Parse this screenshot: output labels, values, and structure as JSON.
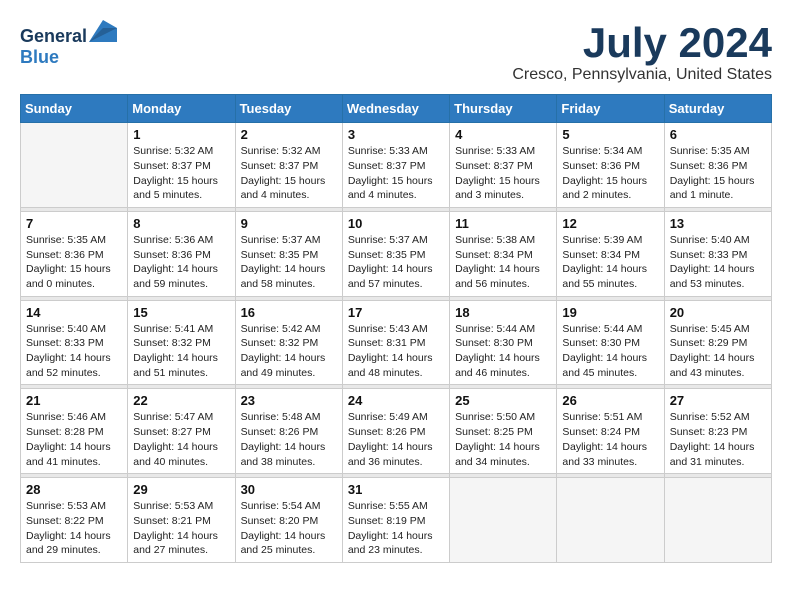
{
  "logo": {
    "general": "General",
    "blue": "Blue"
  },
  "title": "July 2024",
  "subtitle": "Cresco, Pennsylvania, United States",
  "days_of_week": [
    "Sunday",
    "Monday",
    "Tuesday",
    "Wednesday",
    "Thursday",
    "Friday",
    "Saturday"
  ],
  "weeks": [
    [
      {
        "day": "",
        "info": ""
      },
      {
        "day": "1",
        "info": "Sunrise: 5:32 AM\nSunset: 8:37 PM\nDaylight: 15 hours\nand 5 minutes."
      },
      {
        "day": "2",
        "info": "Sunrise: 5:32 AM\nSunset: 8:37 PM\nDaylight: 15 hours\nand 4 minutes."
      },
      {
        "day": "3",
        "info": "Sunrise: 5:33 AM\nSunset: 8:37 PM\nDaylight: 15 hours\nand 4 minutes."
      },
      {
        "day": "4",
        "info": "Sunrise: 5:33 AM\nSunset: 8:37 PM\nDaylight: 15 hours\nand 3 minutes."
      },
      {
        "day": "5",
        "info": "Sunrise: 5:34 AM\nSunset: 8:36 PM\nDaylight: 15 hours\nand 2 minutes."
      },
      {
        "day": "6",
        "info": "Sunrise: 5:35 AM\nSunset: 8:36 PM\nDaylight: 15 hours\nand 1 minute."
      }
    ],
    [
      {
        "day": "7",
        "info": "Sunrise: 5:35 AM\nSunset: 8:36 PM\nDaylight: 15 hours\nand 0 minutes."
      },
      {
        "day": "8",
        "info": "Sunrise: 5:36 AM\nSunset: 8:36 PM\nDaylight: 14 hours\nand 59 minutes."
      },
      {
        "day": "9",
        "info": "Sunrise: 5:37 AM\nSunset: 8:35 PM\nDaylight: 14 hours\nand 58 minutes."
      },
      {
        "day": "10",
        "info": "Sunrise: 5:37 AM\nSunset: 8:35 PM\nDaylight: 14 hours\nand 57 minutes."
      },
      {
        "day": "11",
        "info": "Sunrise: 5:38 AM\nSunset: 8:34 PM\nDaylight: 14 hours\nand 56 minutes."
      },
      {
        "day": "12",
        "info": "Sunrise: 5:39 AM\nSunset: 8:34 PM\nDaylight: 14 hours\nand 55 minutes."
      },
      {
        "day": "13",
        "info": "Sunrise: 5:40 AM\nSunset: 8:33 PM\nDaylight: 14 hours\nand 53 minutes."
      }
    ],
    [
      {
        "day": "14",
        "info": "Sunrise: 5:40 AM\nSunset: 8:33 PM\nDaylight: 14 hours\nand 52 minutes."
      },
      {
        "day": "15",
        "info": "Sunrise: 5:41 AM\nSunset: 8:32 PM\nDaylight: 14 hours\nand 51 minutes."
      },
      {
        "day": "16",
        "info": "Sunrise: 5:42 AM\nSunset: 8:32 PM\nDaylight: 14 hours\nand 49 minutes."
      },
      {
        "day": "17",
        "info": "Sunrise: 5:43 AM\nSunset: 8:31 PM\nDaylight: 14 hours\nand 48 minutes."
      },
      {
        "day": "18",
        "info": "Sunrise: 5:44 AM\nSunset: 8:30 PM\nDaylight: 14 hours\nand 46 minutes."
      },
      {
        "day": "19",
        "info": "Sunrise: 5:44 AM\nSunset: 8:30 PM\nDaylight: 14 hours\nand 45 minutes."
      },
      {
        "day": "20",
        "info": "Sunrise: 5:45 AM\nSunset: 8:29 PM\nDaylight: 14 hours\nand 43 minutes."
      }
    ],
    [
      {
        "day": "21",
        "info": "Sunrise: 5:46 AM\nSunset: 8:28 PM\nDaylight: 14 hours\nand 41 minutes."
      },
      {
        "day": "22",
        "info": "Sunrise: 5:47 AM\nSunset: 8:27 PM\nDaylight: 14 hours\nand 40 minutes."
      },
      {
        "day": "23",
        "info": "Sunrise: 5:48 AM\nSunset: 8:26 PM\nDaylight: 14 hours\nand 38 minutes."
      },
      {
        "day": "24",
        "info": "Sunrise: 5:49 AM\nSunset: 8:26 PM\nDaylight: 14 hours\nand 36 minutes."
      },
      {
        "day": "25",
        "info": "Sunrise: 5:50 AM\nSunset: 8:25 PM\nDaylight: 14 hours\nand 34 minutes."
      },
      {
        "day": "26",
        "info": "Sunrise: 5:51 AM\nSunset: 8:24 PM\nDaylight: 14 hours\nand 33 minutes."
      },
      {
        "day": "27",
        "info": "Sunrise: 5:52 AM\nSunset: 8:23 PM\nDaylight: 14 hours\nand 31 minutes."
      }
    ],
    [
      {
        "day": "28",
        "info": "Sunrise: 5:53 AM\nSunset: 8:22 PM\nDaylight: 14 hours\nand 29 minutes."
      },
      {
        "day": "29",
        "info": "Sunrise: 5:53 AM\nSunset: 8:21 PM\nDaylight: 14 hours\nand 27 minutes."
      },
      {
        "day": "30",
        "info": "Sunrise: 5:54 AM\nSunset: 8:20 PM\nDaylight: 14 hours\nand 25 minutes."
      },
      {
        "day": "31",
        "info": "Sunrise: 5:55 AM\nSunset: 8:19 PM\nDaylight: 14 hours\nand 23 minutes."
      },
      {
        "day": "",
        "info": ""
      },
      {
        "day": "",
        "info": ""
      },
      {
        "day": "",
        "info": ""
      }
    ]
  ]
}
